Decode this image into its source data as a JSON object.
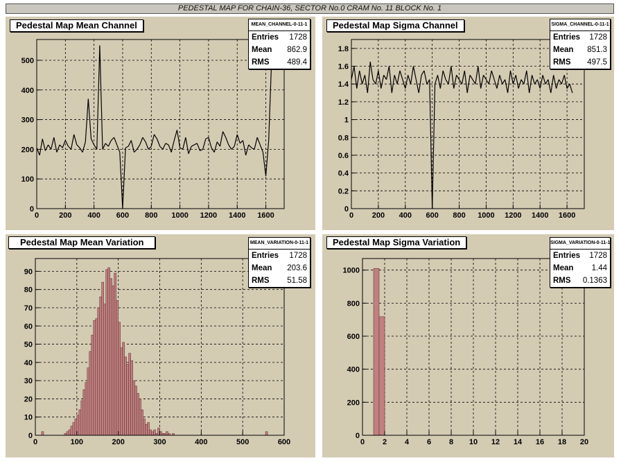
{
  "page_title": "PEDESTAL MAP FOR CHAIN-36, SECTOR No.0 CRAM No. 11 BLOCK No. 1",
  "colors": {
    "pad_bg": "#d4cbb3",
    "hist_fill": "#c08080",
    "line": "#000000"
  },
  "panels": [
    {
      "title": "Pedestal Map Mean Channel",
      "stats": {
        "name": "MEAN_CHANNEL-0-11-1",
        "entries_label": "Entries",
        "entries": "1728",
        "mean_label": "Mean",
        "mean": "862.9",
        "rms_label": "RMS",
        "rms": "489.4"
      }
    },
    {
      "title": "Pedestal Map Sigma Channel",
      "stats": {
        "name": "SIGMA_CHANNEL-0-11-1",
        "entries_label": "Entries",
        "entries": "1728",
        "mean_label": "Mean",
        "mean": "851.3",
        "rms_label": "RMS",
        "rms": "497.5"
      }
    },
    {
      "title": "Pedestal Map Mean Variation",
      "stats": {
        "name": "MEAN_VARIATION-0-11-1",
        "entries_label": "Entries",
        "entries": "1728",
        "mean_label": "Mean",
        "mean": "203.6",
        "rms_label": "RMS",
        "rms": "51.58"
      }
    },
    {
      "title": "Pedestal Map Sigma Variation",
      "stats": {
        "name": "SIGMA_VARIATION-0-11-1",
        "entries_label": "Entries",
        "entries": "1728",
        "mean_label": "Mean",
        "mean": "1.44",
        "rms_label": "RMS",
        "rms": "0.1363"
      }
    }
  ],
  "chart_data": [
    {
      "type": "line",
      "title": "Pedestal Map Mean Channel",
      "xlim": [
        0,
        1728
      ],
      "ylim": [
        0,
        570
      ],
      "grid": true,
      "xticks": [
        "0",
        "200",
        "400",
        "600",
        "800",
        "1000",
        "1200",
        "1400",
        "1600"
      ],
      "yticks": [
        "0",
        "100",
        "200",
        "300",
        "400",
        "500"
      ],
      "x_tick_values": [
        0,
        200,
        400,
        600,
        800,
        1000,
        1200,
        1400,
        1600
      ],
      "y_tick_values": [
        0,
        100,
        200,
        300,
        400,
        500
      ],
      "x_step": 20,
      "values": [
        205,
        180,
        235,
        195,
        215,
        200,
        240,
        190,
        215,
        205,
        230,
        210,
        200,
        250,
        215,
        205,
        190,
        225,
        370,
        235,
        215,
        200,
        550,
        200,
        220,
        210,
        230,
        240,
        215,
        190,
        0,
        205,
        210,
        230,
        190,
        200,
        215,
        240,
        225,
        200,
        210,
        250,
        235,
        210,
        200,
        220,
        215,
        190,
        230,
        265,
        205,
        200,
        240,
        185,
        210,
        215,
        220,
        195,
        200,
        235,
        240,
        205,
        190,
        225,
        210,
        260,
        240,
        215,
        200,
        210,
        250,
        220,
        230,
        180,
        215,
        205,
        200,
        240,
        215,
        190,
        110,
        230,
        500
      ],
      "stroke": "#000000"
    },
    {
      "type": "line",
      "title": "Pedestal Map Sigma Channel",
      "xlim": [
        0,
        1728
      ],
      "ylim": [
        0,
        1.9
      ],
      "grid": true,
      "xticks": [
        "0",
        "200",
        "400",
        "600",
        "800",
        "1000",
        "1200",
        "1400",
        "1600"
      ],
      "yticks": [
        "0",
        "0.2",
        "0.4",
        "0.6",
        "0.8",
        "1",
        "1.2",
        "1.4",
        "1.6",
        "1.8"
      ],
      "x_tick_values": [
        0,
        200,
        400,
        600,
        800,
        1000,
        1200,
        1400,
        1600
      ],
      "y_tick_values": [
        0,
        0.2,
        0.4,
        0.6,
        0.8,
        1,
        1.2,
        1.4,
        1.6,
        1.8
      ],
      "x_step": 20,
      "values": [
        1.45,
        1.6,
        1.35,
        1.55,
        1.4,
        1.5,
        1.3,
        1.65,
        1.45,
        1.4,
        1.55,
        1.35,
        1.5,
        1.45,
        1.6,
        1.3,
        1.5,
        1.4,
        1.55,
        1.45,
        1.35,
        1.5,
        1.4,
        1.6,
        1.45,
        1.3,
        1.5,
        1.55,
        1.4,
        1.45,
        0.0,
        1.4,
        1.5,
        1.35,
        1.55,
        1.45,
        1.4,
        1.6,
        1.35,
        1.5,
        1.45,
        1.4,
        1.55,
        1.3,
        1.5,
        1.45,
        1.4,
        1.6,
        1.35,
        1.5,
        1.45,
        1.4,
        1.55,
        1.45,
        1.35,
        1.5,
        1.4,
        1.45,
        1.3,
        1.55,
        1.4,
        1.5,
        1.35,
        1.45,
        1.4,
        1.55,
        1.3,
        1.5,
        1.4,
        1.45,
        1.35,
        1.5,
        1.4,
        1.45,
        1.3,
        1.5,
        1.35,
        1.45,
        1.4,
        1.5,
        1.35,
        1.4,
        1.3
      ],
      "stroke": "#000000"
    },
    {
      "type": "bar",
      "title": "Pedestal Map Mean Variation",
      "xlim": [
        0,
        600
      ],
      "ylim": [
        0,
        97
      ],
      "grid": true,
      "xticks": [
        "0",
        "100",
        "200",
        "300",
        "400",
        "500",
        "600"
      ],
      "yticks": [
        "0",
        "10",
        "20",
        "30",
        "40",
        "50",
        "60",
        "70",
        "80",
        "90"
      ],
      "x_tick_values": [
        0,
        100,
        200,
        300,
        400,
        500,
        600
      ],
      "y_tick_values": [
        0,
        10,
        20,
        30,
        40,
        50,
        60,
        70,
        80,
        90
      ],
      "bin_start": 0,
      "bin_width": 5,
      "values": [
        0,
        0,
        0,
        2,
        0,
        0,
        0,
        0,
        0,
        0,
        0,
        0,
        0,
        0,
        1,
        2,
        3,
        5,
        7,
        9,
        11,
        14,
        19,
        25,
        29,
        37,
        46,
        55,
        63,
        64,
        70,
        76,
        84,
        72,
        91,
        92,
        86,
        82,
        89,
        74,
        62,
        48,
        51,
        43,
        39,
        45,
        41,
        30,
        27,
        23,
        20,
        14,
        9,
        6,
        7,
        3,
        2,
        3,
        1,
        4,
        2,
        1,
        1,
        2,
        1,
        0,
        1,
        0,
        0,
        0,
        0,
        0,
        0,
        0,
        0,
        0,
        0,
        0,
        0,
        0,
        0,
        0,
        0,
        0,
        0,
        0,
        0,
        0,
        0,
        0,
        0,
        0,
        0,
        0,
        0,
        0,
        0,
        0,
        0,
        0,
        0,
        0,
        0,
        0,
        0,
        0,
        0,
        0,
        0,
        0,
        0,
        2,
        0,
        0,
        0,
        0,
        0,
        0,
        0,
        0
      ],
      "fill": "#c08080"
    },
    {
      "type": "bar",
      "title": "Pedestal Map Sigma Variation",
      "xlim": [
        0,
        20
      ],
      "ylim": [
        0,
        1070
      ],
      "grid": true,
      "xticks": [
        "0",
        "2",
        "4",
        "6",
        "8",
        "10",
        "12",
        "14",
        "16",
        "18",
        "20"
      ],
      "yticks": [
        "0",
        "200",
        "400",
        "600",
        "800",
        "1000"
      ],
      "x_tick_values": [
        0,
        2,
        4,
        6,
        8,
        10,
        12,
        14,
        16,
        18,
        20
      ],
      "y_tick_values": [
        0,
        200,
        400,
        600,
        800,
        1000
      ],
      "bin_start": 1.0,
      "bin_width": 0.5,
      "values": [
        1010,
        718
      ],
      "fill": "#c08080"
    }
  ]
}
